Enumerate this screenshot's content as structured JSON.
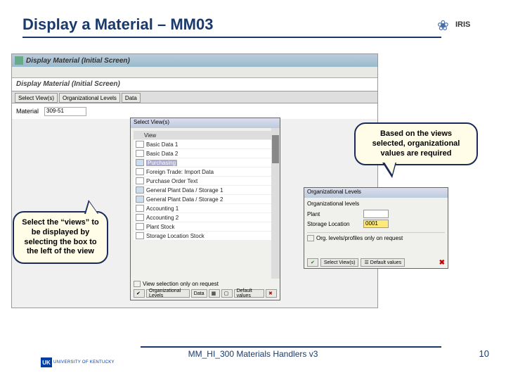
{
  "title": "Display a Material – MM03",
  "logo": {
    "text": "IRIS"
  },
  "shot": {
    "titlebar": "Display Material (Initial Screen)",
    "subtitle": "Display Material (Initial Screen)",
    "btns": {
      "a": "Select View(s)",
      "b": "Organizational Levels",
      "c": "Data"
    },
    "mat_label": "Material",
    "mat_value": "309-51"
  },
  "views_modal": {
    "head": "Select View(s)",
    "group": "View",
    "items": [
      {
        "label": "Basic Data 1",
        "checked": false
      },
      {
        "label": "Basic Data 2",
        "checked": false
      },
      {
        "label": "Purchasing",
        "checked": true,
        "hl": true
      },
      {
        "label": "Foreign Trade: Import Data",
        "checked": false
      },
      {
        "label": "Purchase Order Text",
        "checked": false
      },
      {
        "label": "General Plant Data / Storage 1",
        "checked": true
      },
      {
        "label": "General Plant Data / Storage 2",
        "checked": true
      },
      {
        "label": "Accounting 1",
        "checked": false
      },
      {
        "label": "Accounting 2",
        "checked": false
      },
      {
        "label": "Plant Stock",
        "checked": false
      },
      {
        "label": "Storage Location Stock",
        "checked": false
      }
    ],
    "foot_chk": "View selection only on request",
    "fbtn": {
      "org": "Organizational Levels",
      "data": "Data",
      "def": "Default values"
    }
  },
  "org_modal": {
    "head": "Organizational Levels",
    "sub": "Organizational levels",
    "rows": {
      "plant": "Plant",
      "sloc": "Storage Location"
    },
    "sloc_value": "0001",
    "chk": "Org. levels/profiles only on request",
    "fbtn": {
      "sel": "Select View(s)",
      "def": "Default values"
    }
  },
  "callouts": {
    "c1": "Select the “views” to be displayed by selecting the box to the left of the view",
    "c2": "Based on the views selected, organizational values are required"
  },
  "footer": {
    "uk": "UK",
    "uk_txt": "UNIVERSITY OF KENTUCKY",
    "center": "MM_HI_300 Materials Handlers v3",
    "page": "10"
  }
}
